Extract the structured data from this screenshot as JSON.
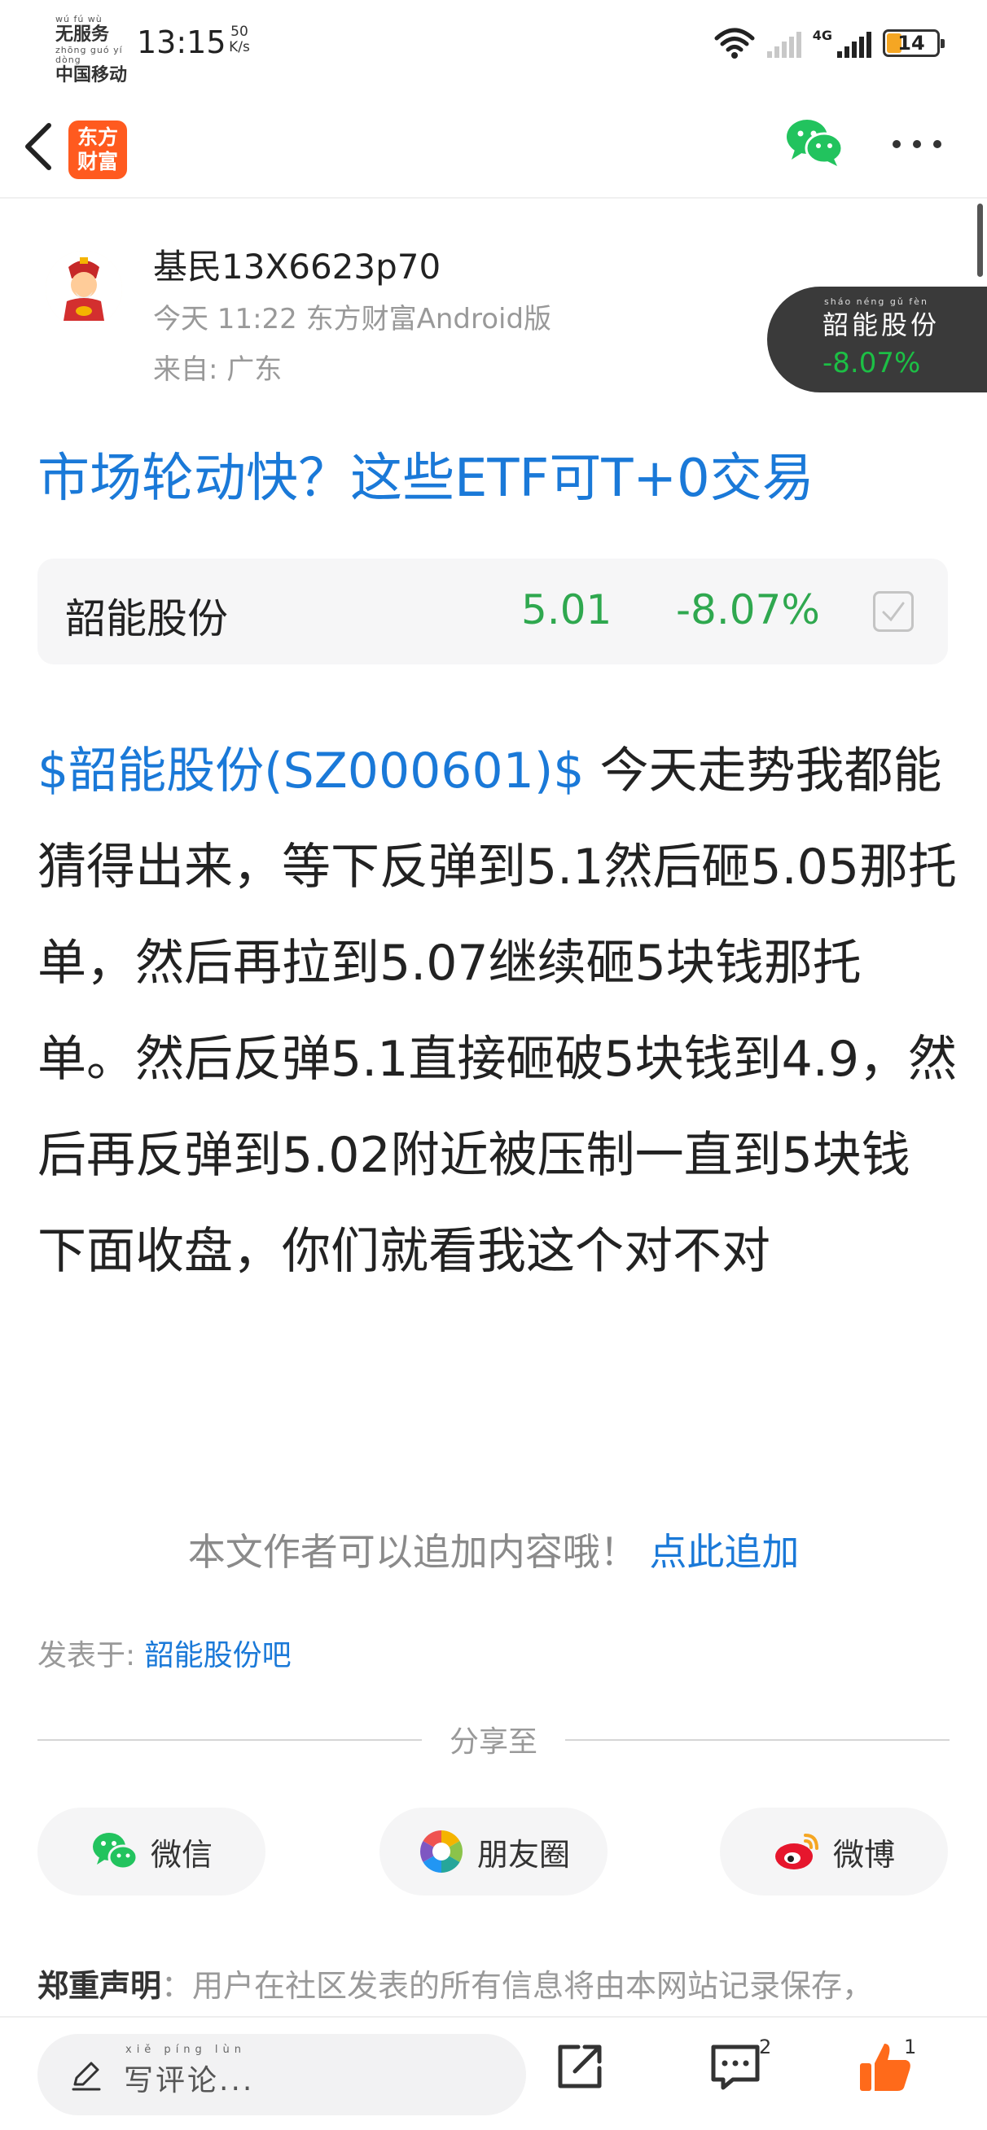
{
  "status_bar": {
    "carrier_line1_pinyin": "wú fú wù",
    "carrier_line1": "无服务",
    "carrier_line2_pinyin": "zhōng guó yí dòng",
    "carrier_line2": "中国移动",
    "time": "13:15",
    "net_speed_value": "50",
    "net_speed_unit": "K/s",
    "network": "4G",
    "battery": "14",
    "battery_color": "#f5a623"
  },
  "nav": {
    "app_logo_line1": "东方",
    "app_logo_line2": "财富",
    "brand_color": "#ff5a1f"
  },
  "author": {
    "name": "基民13X6623p70",
    "post_meta": "今天 11:22 东方财富Android版",
    "location": "来自: 广东"
  },
  "floating_stock": {
    "pinyin": "sháo néng gǔ fèn",
    "name": "韶能股份",
    "change": "-8.07%"
  },
  "post": {
    "title": "市场轮动快？这些ETF可T+0交易",
    "stock_card": {
      "name": "韶能股份",
      "price": "5.01",
      "change": "-8.07%"
    },
    "stock_link": "$韶能股份(SZ000601)$",
    "body": " 今天走势我都能猜得出来，等下反弹到5.1然后砸5.05那托单，然后再拉到5.07继续砸5块钱那托单。然后反弹5.1直接砸破5块钱到4.9，然后再反弹到5.02附近被压制一直到5块钱下面收盘，你们就看我这个对不对",
    "append_hint": "本文作者可以追加内容哦！",
    "append_link": "点此追加",
    "posted_in_label": "发表于: ",
    "posted_in_bar": "韶能股份吧"
  },
  "share": {
    "label": "分享至",
    "wechat": "微信",
    "moments": "朋友圈",
    "weibo": "微博"
  },
  "disclaimer": {
    "head": "郑重声明",
    "text": "：用户在社区发表的所有信息将由本网站记录保存，"
  },
  "bottom_bar": {
    "comment_pinyin": "xiě píng lùn",
    "comment_placeholder": "写评论...",
    "comment_count": "2",
    "like_count": "1"
  },
  "colors": {
    "link_blue": "#1a79d8",
    "down_green": "#2fa84f",
    "like_orange": "#ff6a1a"
  },
  "icons": [
    "back-icon",
    "wechat-icon",
    "more-icon",
    "check-icon",
    "moments-icon",
    "weibo-icon",
    "edit-icon",
    "share-icon",
    "comment-icon",
    "like-icon",
    "wifi-icon",
    "signal-icon",
    "battery-icon"
  ]
}
